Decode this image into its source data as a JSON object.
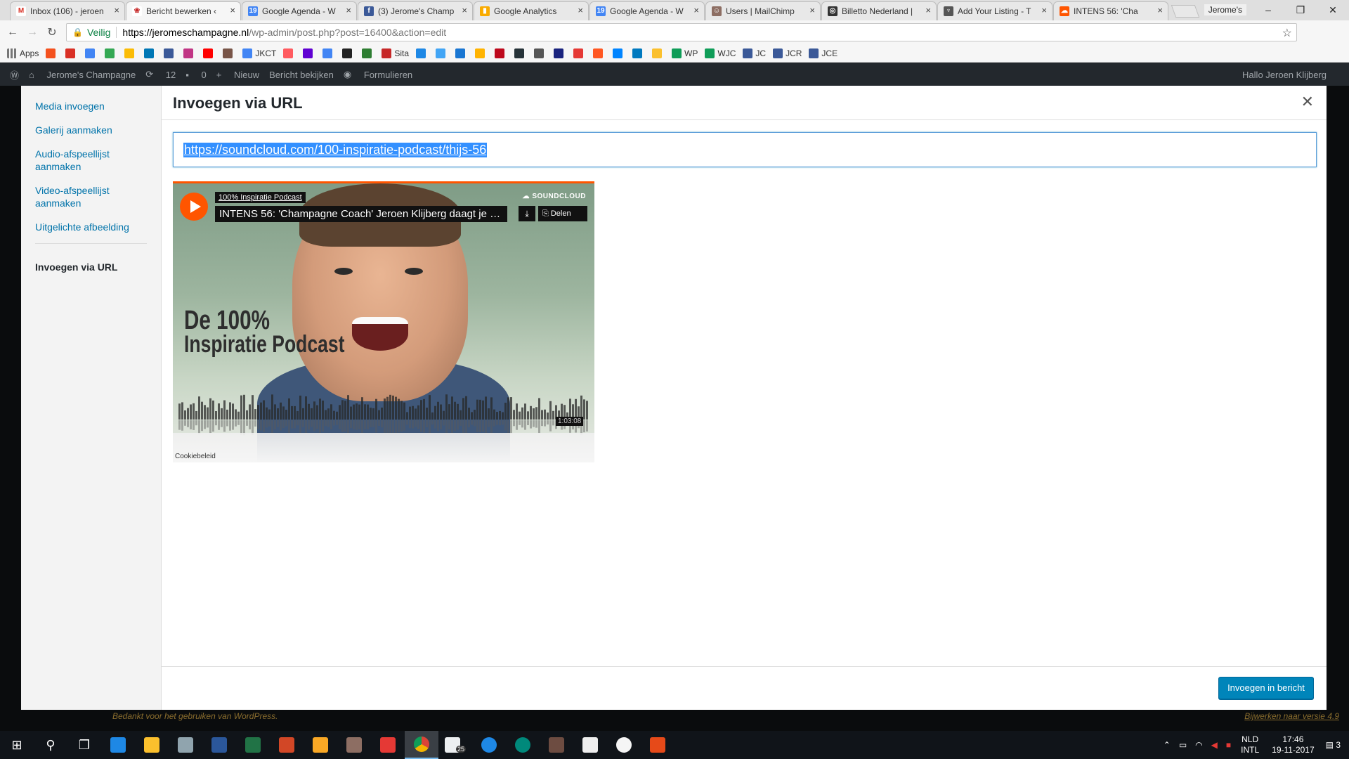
{
  "browser": {
    "tabs": [
      {
        "label": "Inbox (106) - jeroen",
        "favicon_color": "#d93025",
        "favicon_glyph": "M",
        "active": false
      },
      {
        "label": "Bericht bewerken ‹",
        "favicon_color": "#c62828",
        "favicon_glyph": "❀",
        "active": true
      },
      {
        "label": "Google Agenda - W",
        "favicon_color": "#4285f4",
        "favicon_glyph": "19",
        "active": false
      },
      {
        "label": "(3) Jerome's Champ",
        "favicon_color": "#3b5998",
        "favicon_glyph": "f",
        "active": false
      },
      {
        "label": "Google Analytics",
        "favicon_color": "#f9ab00",
        "favicon_glyph": "▮",
        "active": false
      },
      {
        "label": "Google Agenda - W",
        "favicon_color": "#4285f4",
        "favicon_glyph": "19",
        "active": false
      },
      {
        "label": "Users | MailChimp",
        "favicon_color": "#8d6e63",
        "favicon_glyph": "☺",
        "active": false
      },
      {
        "label": "Billetto Nederland |",
        "favicon_color": "#333333",
        "favicon_glyph": "◎",
        "active": false
      },
      {
        "label": "Add Your Listing - T",
        "favicon_color": "#555555",
        "favicon_glyph": "♆",
        "active": false
      },
      {
        "label": "INTENS 56: 'Cha",
        "favicon_color": "#ff5500",
        "favicon_glyph": "☁",
        "active": false
      }
    ],
    "profile_name": "Jerome's",
    "address": {
      "secure_label": "Veilig",
      "url_host": "https://jeromeschampagne.nl",
      "url_path": "/wp-admin/post.php?post=16400&action=edit"
    },
    "bookmarks": [
      {
        "label": "Apps",
        "color": "#777777"
      },
      {
        "label": "",
        "color": "#f4511e"
      },
      {
        "label": "",
        "color": "#d93025"
      },
      {
        "label": "",
        "color": "#4285f4"
      },
      {
        "label": "",
        "color": "#34a853"
      },
      {
        "label": "JKCT",
        "color": "#4285f4"
      },
      {
        "label": "Sita",
        "color": "#c62828"
      },
      {
        "label": "WP",
        "color": "#0f9d58"
      },
      {
        "label": "WJC",
        "color": "#0f9d58"
      },
      {
        "label": "JC",
        "color": "#3b5998"
      },
      {
        "label": "JCR",
        "color": "#3b5998"
      },
      {
        "label": "JCE",
        "color": "#3b5998"
      }
    ]
  },
  "wp_admin_bar": {
    "site_name": "Jerome's Champagne",
    "updates_count": "12",
    "comments_count": "0",
    "new_label": "Nieuw",
    "view_post_label": "Bericht bekijken",
    "forms_label": "Formulieren",
    "greeting": "Hallo Jeroen Klijberg"
  },
  "modal": {
    "menu": [
      {
        "label": "Media invoegen",
        "current": false
      },
      {
        "label": "Galerij aanmaken",
        "current": false
      },
      {
        "label": "Audio-afspeellijst aanmaken",
        "current": false
      },
      {
        "label": "Video-afspeellijst aanmaken",
        "current": false
      },
      {
        "label": "Uitgelichte afbeelding",
        "current": false
      },
      {
        "label": "Invoegen via URL",
        "current": true
      }
    ],
    "title": "Invoegen via URL",
    "url_value": "https://soundcloud.com/100-inspiratie-podcast/thijs-56",
    "insert_button": "Invoegen in bericht"
  },
  "soundcloud_embed": {
    "user": "100% Inspiratie Podcast",
    "track_title": "INTENS 56: 'Champagne Coach' Jeroen Klijberg daagt je ui...",
    "brand": "SOUNDCLOUD",
    "share_label": "Delen",
    "duration": "1:03:08",
    "cookie_label": "Cookiebeleid",
    "artwork_line1": "De 100%",
    "artwork_line2": "Inspiratie Podcast"
  },
  "page_footer": {
    "thanks_text": "Bedankt voor het gebruiken van WordPress.",
    "update_link": "Bijwerken naar versie 4.9"
  },
  "taskbar": {
    "mail_badge": "25",
    "language": "NLD",
    "layout": "INTL",
    "time": "17:46",
    "date": "19-11-2017",
    "notifications": "3"
  }
}
